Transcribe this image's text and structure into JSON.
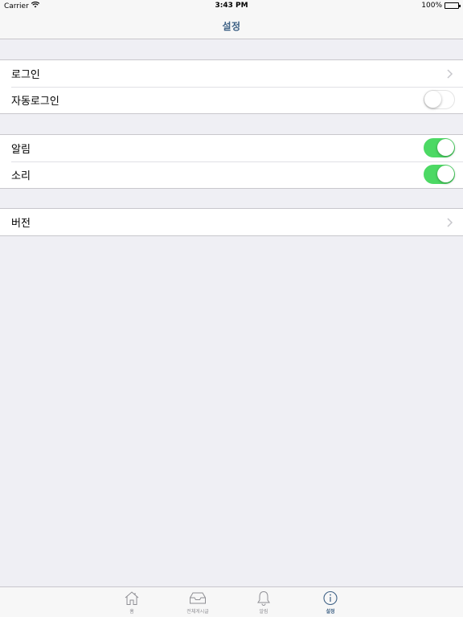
{
  "status_bar": {
    "carrier": "Carrier",
    "time": "3:43 PM",
    "battery": "100%"
  },
  "nav": {
    "title": "설정"
  },
  "groups": [
    {
      "rows": [
        {
          "label": "로그인",
          "accessory": "chevron"
        },
        {
          "label": "자동로그인",
          "accessory": "switch",
          "on": false
        }
      ]
    },
    {
      "rows": [
        {
          "label": "알림",
          "accessory": "switch",
          "on": true
        },
        {
          "label": "소리",
          "accessory": "switch",
          "on": true
        }
      ]
    },
    {
      "rows": [
        {
          "label": "버전",
          "accessory": "chevron"
        }
      ]
    }
  ],
  "tabs": [
    {
      "label": "홈",
      "icon": "home-icon",
      "active": false
    },
    {
      "label": "전체게시글",
      "icon": "inbox-icon",
      "active": false
    },
    {
      "label": "알림",
      "icon": "bell-icon",
      "active": false
    },
    {
      "label": "설정",
      "icon": "info-icon",
      "active": true
    }
  ],
  "colors": {
    "accent": "#3e6185",
    "switch_on": "#4cd964",
    "background": "#efeff4",
    "inactive_tab": "#8e8e93"
  }
}
